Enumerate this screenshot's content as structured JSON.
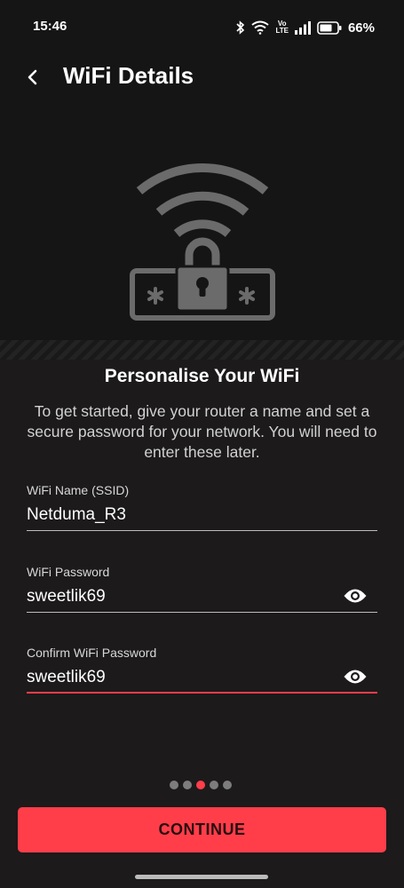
{
  "status_bar": {
    "time": "15:46",
    "volte_top": "Vo",
    "volte_bottom": "LTE",
    "battery_percent": "66%",
    "icons": [
      "bluetooth-icon",
      "wifi-icon",
      "volte-icon",
      "signal-icon",
      "battery-icon"
    ]
  },
  "header": {
    "back_icon": "back-arrow-icon",
    "title": "WiFi Details"
  },
  "hero": {
    "icon": "wifi-lock-password-illustration"
  },
  "content": {
    "heading": "Personalise Your WiFi",
    "description": "To get started, give your router a name and set a secure password for your network. You will need to enter these later."
  },
  "form": {
    "ssid": {
      "label": "WiFi Name (SSID)",
      "value": "Netduma_R3"
    },
    "password": {
      "label": "WiFi Password",
      "value": "sweetlik69",
      "toggle_icon": "eye-icon"
    },
    "confirm_password": {
      "label": "Confirm WiFi Password",
      "value": "sweetlik69",
      "toggle_icon": "eye-icon"
    }
  },
  "pager": {
    "total": 5,
    "active_index": 2
  },
  "footer": {
    "continue_label": "CONTINUE"
  },
  "colors": {
    "accent": "#ff3e4a",
    "background": "#1c1a1b",
    "hero_background": "#151515"
  }
}
